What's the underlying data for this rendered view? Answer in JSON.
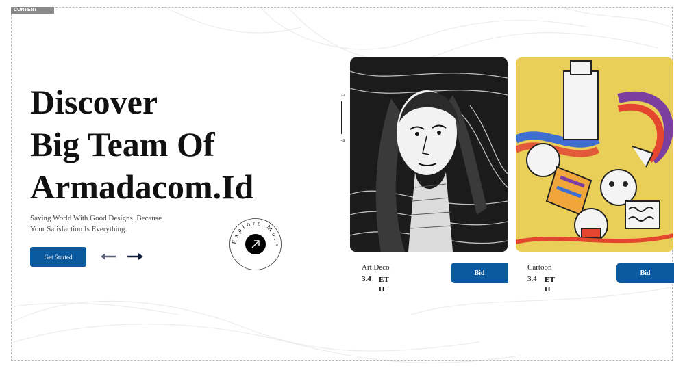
{
  "frame": {
    "tag": "CONTENT"
  },
  "hero": {
    "title_lines": [
      "Discover",
      "Big Team Of",
      "Armadacom.Id"
    ],
    "subtitle": "Saving World With Good Designs. Because Your Satisfaction Is Everything.",
    "cta_label": "Get Started"
  },
  "nav_arrows": {
    "prev_icon": "arrow-left-icon",
    "next_icon": "arrow-right-icon"
  },
  "explore_badge": {
    "text": "Explore More",
    "icon": "arrow-up-right-icon"
  },
  "slider_counter": {
    "current": "3",
    "total": "7"
  },
  "cards": [
    {
      "title": "Art Deco",
      "price": "3.4",
      "unit": "ETH",
      "bid_label": "Bid",
      "art": "black-and-white engraving of a woman"
    },
    {
      "title": "Cartoon",
      "price": "3.4",
      "unit": "ETH",
      "bid_label": "Bid",
      "art": "colorful doodle graffiti mural"
    }
  ],
  "colors": {
    "accent": "#0b5aa0",
    "text": "#111111",
    "secondary_arrow": "#5a6378",
    "primary_arrow": "#0d1b3d"
  }
}
